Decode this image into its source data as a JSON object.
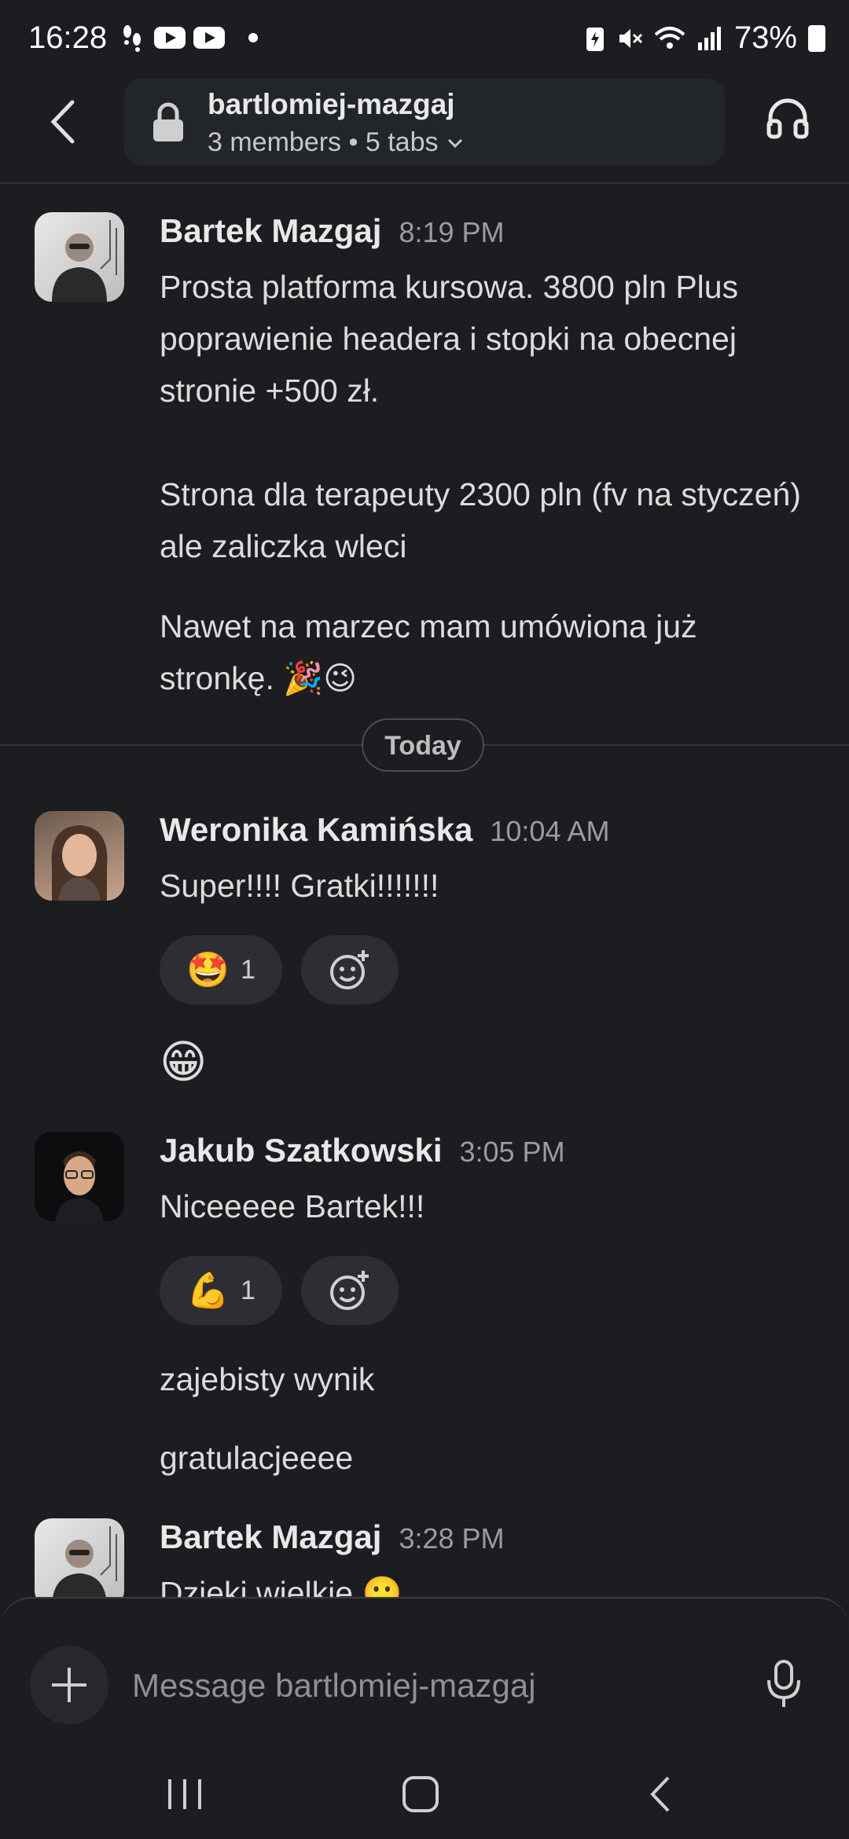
{
  "status_bar": {
    "time": "16:28",
    "battery": "73%"
  },
  "header": {
    "channel_name": "bartlomiej-mazgaj",
    "members": "3 members",
    "tabs": "5 tabs",
    "separator": " • "
  },
  "messages": [
    {
      "author": "Bartek Mazgaj",
      "time": "8:19 PM",
      "paragraphs": [
        "Prosta platforma kursowa. 3800 pln Plus poprawienie headera i stopki na obecnej stronie  +500 zł.",
        "Strona dla terapeuty 2300 pln (fv na styczeń) ale zaliczka wleci",
        "Nawet na marzec mam umówiona już stronkę. 🎉😉"
      ]
    },
    {
      "author": "Weronika Kamińska",
      "time": "10:04 AM",
      "paragraphs": [
        "Super!!!! Gratki!!!!!!!"
      ],
      "reaction": {
        "emoji": "🤩",
        "count": "1"
      },
      "followups": [
        "😁"
      ]
    },
    {
      "author": "Jakub Szatkowski",
      "time": "3:05 PM",
      "paragraphs": [
        "Niceeeee Bartek!!!"
      ],
      "reaction": {
        "emoji": "💪",
        "count": "1"
      },
      "followups": [
        "zajebisty wynik",
        "gratulacjeeee"
      ]
    },
    {
      "author": "Bartek Mazgaj",
      "time": "3:28 PM",
      "paragraphs": [
        "Dzieki wielkie 🙂"
      ]
    }
  ],
  "day_divider": "Today",
  "composer": {
    "placeholder": "Message bartlomiej-mazgaj"
  },
  "colors": {
    "background": "#1b1d21",
    "pill": "#222529",
    "reaction": "#2c2e33"
  }
}
